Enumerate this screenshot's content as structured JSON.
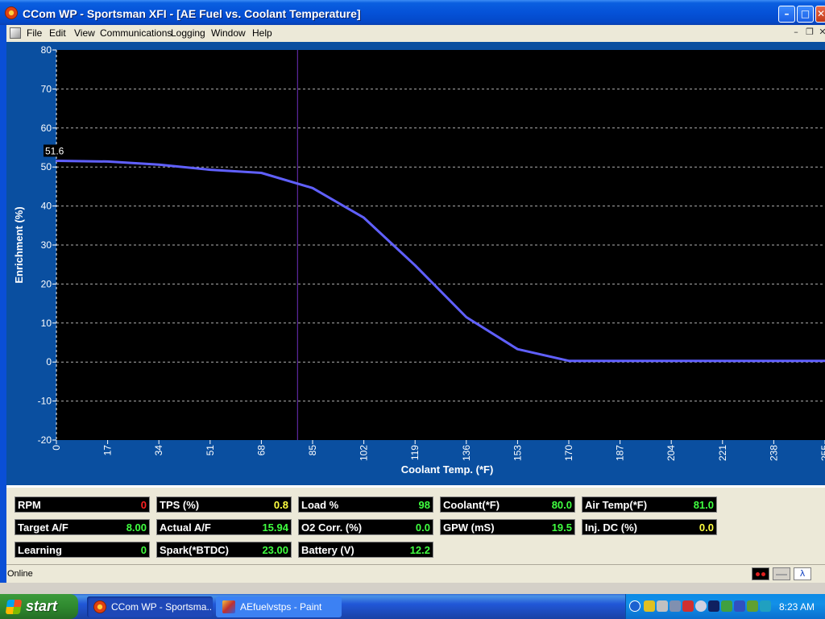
{
  "window": {
    "title": "CCom WP - Sportsman XFI  - [AE Fuel vs. Coolant Temperature]",
    "min_glyph": "–",
    "max_glyph": "□",
    "close_glyph": "✕"
  },
  "menu": {
    "items": [
      "File",
      "Edit",
      "View",
      "Communications",
      "Logging",
      "Window",
      "Help"
    ],
    "mdi_min": "–",
    "mdi_restore": "❐",
    "mdi_close": "✕"
  },
  "chart_data": {
    "type": "line",
    "xlabel": "Coolant Temp. (*F)",
    "ylabel": "Enrichment (%)",
    "x_ticks": [
      0,
      17,
      34,
      51,
      68,
      85,
      102,
      119,
      136,
      153,
      170,
      187,
      204,
      221,
      238,
      255
    ],
    "y_ticks": [
      -20,
      -10,
      0,
      10,
      20,
      30,
      40,
      50,
      60,
      70,
      80
    ],
    "xlim": [
      0,
      255
    ],
    "ylim": [
      -20,
      80
    ],
    "grid": true,
    "cursor_x": 80,
    "cursor_label": "51.6",
    "cursor_label_y": 51.6,
    "series": [
      {
        "x": [
          0,
          17,
          34,
          51,
          68,
          85,
          102,
          119,
          136,
          153,
          170,
          187,
          204,
          221,
          238,
          255
        ],
        "y": [
          51.6,
          51.4,
          50.6,
          49.3,
          48.5,
          44.6,
          37.0,
          24.8,
          11.5,
          3.3,
          0.3,
          0.3,
          0.3,
          0.3,
          0.3,
          0.3
        ]
      }
    ],
    "colors": {
      "background": "#000000",
      "panel": "#0a4fa0",
      "line": "#6060ff",
      "cursor": "#7030c0",
      "grid": "#b0b0b0"
    }
  },
  "gauges": [
    {
      "label": "RPM",
      "value": "0",
      "color": "#ff2020"
    },
    {
      "label": "TPS (%)",
      "value": "0.8",
      "color": "#ffff40"
    },
    {
      "label": "Load %",
      "value": "98",
      "color": "#40ff40"
    },
    {
      "label": "Coolant(*F)",
      "value": "80.0",
      "color": "#40ff40"
    },
    {
      "label": "Air Temp(*F)",
      "value": "81.0",
      "color": "#40ff40"
    },
    {
      "label": "Target A/F",
      "value": "8.00",
      "color": "#40ff40"
    },
    {
      "label": "Actual A/F",
      "value": "15.94",
      "color": "#40ff40"
    },
    {
      "label": "O2 Corr. (%)",
      "value": "0.0",
      "color": "#40ff40"
    },
    {
      "label": "GPW (mS)",
      "value": "19.5",
      "color": "#40ff40"
    },
    {
      "label": "Inj. DC (%)",
      "value": "0.0",
      "color": "#ffff40"
    },
    {
      "label": "Learning",
      "value": "0",
      "color": "#40ff40"
    },
    {
      "label": "Spark(*BTDC)",
      "value": "23.00",
      "color": "#40ff40"
    },
    {
      "label": "Battery (V)",
      "value": "12.2",
      "color": "#40ff40"
    }
  ],
  "status": {
    "text": "Online",
    "icon_names": [
      "connection-status-icon",
      "plug-icon",
      "o2-sensor-icon"
    ]
  },
  "taskbar": {
    "start_label": "start",
    "tasks": [
      {
        "label": "CCom WP - Sportsma...",
        "icon": "ccom-app-icon"
      },
      {
        "label": "AEfuelvstps - Paint",
        "icon": "paint-app-icon"
      }
    ],
    "clock": "8:23 AM"
  }
}
